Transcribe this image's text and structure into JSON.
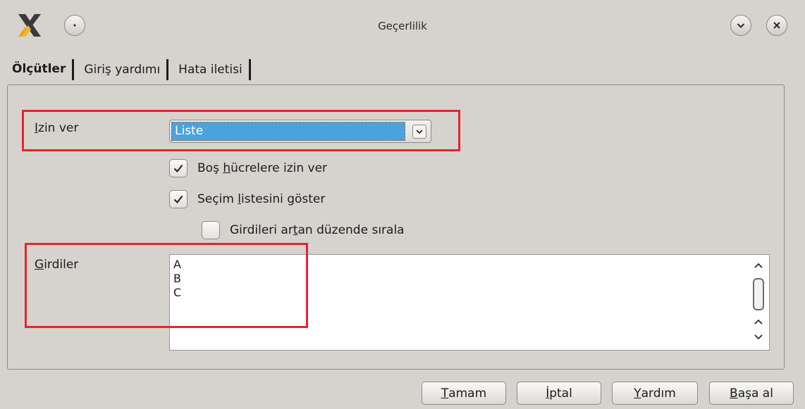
{
  "window": {
    "title": "Geçerlilik",
    "logo_icon": "x-app-logo-icon",
    "menu_icon": "window-menu-icon",
    "minimize_icon": "chevron-down-icon",
    "close_icon": "close-icon"
  },
  "tabs": [
    {
      "label": "Ölçütler",
      "active": true
    },
    {
      "label": "Giriş yardımı",
      "active": false
    },
    {
      "label": "Hata iletisi",
      "active": false
    }
  ],
  "criteria": {
    "allow": {
      "label_mnemonic": "I",
      "label_rest": "zin ver",
      "value": "Liste"
    },
    "checkboxes": [
      {
        "pre": "Boş ",
        "mnemonic": "h",
        "post": "ücrelere izin ver",
        "checked": true
      },
      {
        "pre": "Seçim ",
        "mnemonic": "l",
        "post": "istesini göster",
        "checked": true
      },
      {
        "pre": "Girdileri ar",
        "mnemonic": "t",
        "post": "an düzende sırala",
        "checked": false
      }
    ],
    "entries": {
      "label_mnemonic": "G",
      "label_rest": "irdiler",
      "items": [
        "A",
        "B",
        "C"
      ]
    }
  },
  "buttons": {
    "ok": {
      "mnemonic": "T",
      "rest": "amam"
    },
    "cancel": {
      "mnemonic": "İ",
      "rest": "ptal"
    },
    "help": {
      "mnemonic": "Y",
      "rest": "ardım"
    },
    "reset": {
      "mnemonic": "B",
      "rest": "aşa al"
    }
  },
  "colors": {
    "selection": "#4aa3dd",
    "highlight_box": "#e8232f",
    "background": "#d6d3cf"
  }
}
